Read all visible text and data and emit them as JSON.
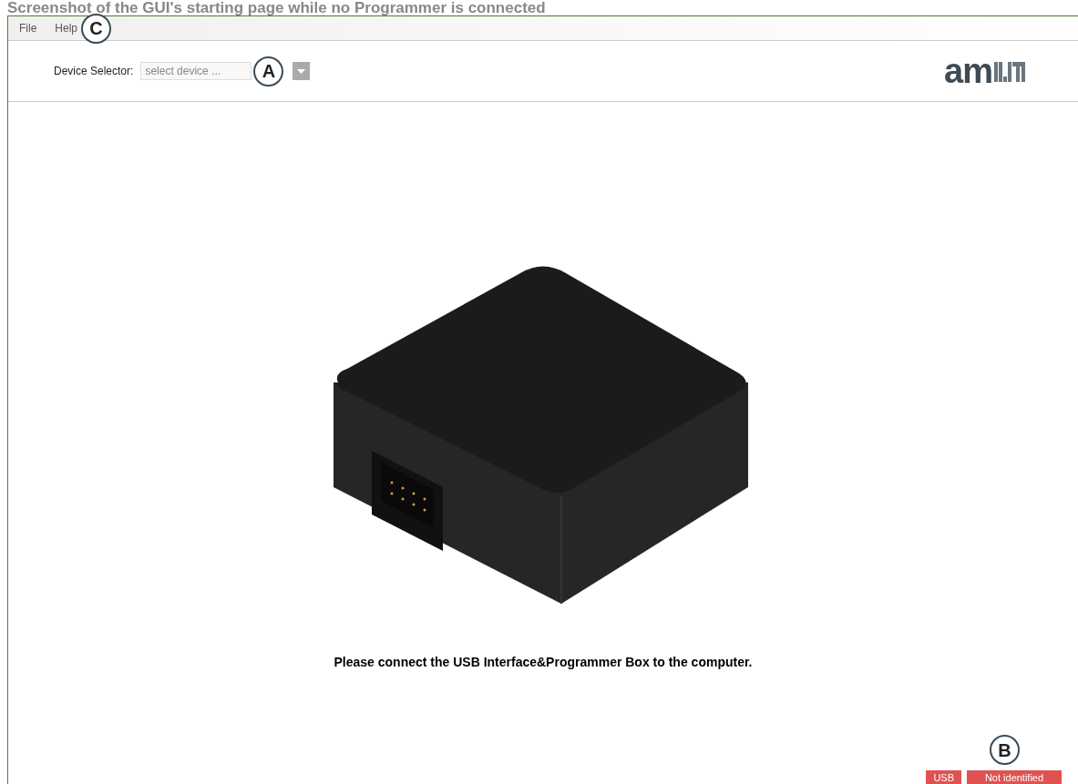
{
  "caption": "Screenshot of the GUI's starting page while no Programmer is connected",
  "menu": {
    "items": [
      {
        "label": "File"
      },
      {
        "label": "Help"
      }
    ],
    "callout": "C"
  },
  "device_selector": {
    "label": "Device Selector:",
    "placeholder": "select device ...",
    "callout": "A"
  },
  "logo": {
    "text": "am"
  },
  "message": "Please connect the USB Interface&Programmer Box to the computer.",
  "status": {
    "callout": "B",
    "badges": [
      {
        "label": "USB",
        "color": "#e05252"
      },
      {
        "label": "Not identified",
        "color": "#e05252"
      }
    ]
  }
}
